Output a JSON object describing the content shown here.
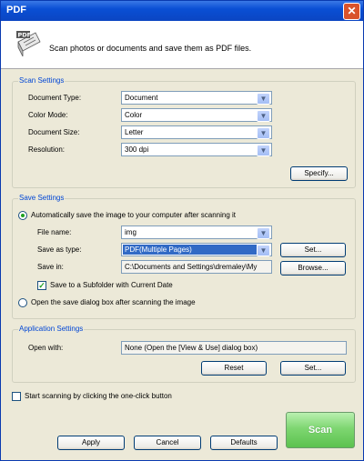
{
  "window": {
    "title": "PDF",
    "close_glyph": "✕"
  },
  "header": {
    "icon_text": "PDF",
    "description": "Scan photos or documents and save them as PDF files."
  },
  "scan_settings": {
    "legend": "Scan Settings",
    "document_type": {
      "label": "Document Type:",
      "value": "Document"
    },
    "color_mode": {
      "label": "Color Mode:",
      "value": "Color"
    },
    "document_size": {
      "label": "Document Size:",
      "value": "Letter"
    },
    "resolution": {
      "label": "Resolution:",
      "value": "300 dpi"
    },
    "specify_button": "Specify..."
  },
  "save_settings": {
    "legend": "Save Settings",
    "auto_save_label": "Automatically save the image to your computer after scanning it",
    "auto_save_selected": true,
    "file_name": {
      "label": "File name:",
      "value": "img"
    },
    "save_as_type": {
      "label": "Save as  type:",
      "value": "PDF(Multiple Pages)"
    },
    "set_button": "Set...",
    "save_in": {
      "label": "Save in:",
      "value": "C:\\Documents and Settings\\dremaley\\My"
    },
    "browse_button": "Browse...",
    "subfolder_label": "Save to a Subfolder with Current Date",
    "subfolder_checked": true,
    "open_dialog_label": "Open the save dialog box after scanning the image",
    "open_dialog_selected": false
  },
  "application_settings": {
    "legend": "Application Settings",
    "open_with_label": "Open with:",
    "open_with_value": "None (Open the [View & Use] dialog box)",
    "reset_button": "Reset",
    "set_button": "Set..."
  },
  "one_click": {
    "label": "Start scanning by clicking the one-click button",
    "checked": false
  },
  "footer": {
    "apply": "Apply",
    "cancel": "Cancel",
    "defaults": "Defaults",
    "scan": "Scan"
  },
  "colors": {
    "accent": "#0046d5",
    "title_bar": "#0a4fd4",
    "scan_button": "#7ed671"
  }
}
